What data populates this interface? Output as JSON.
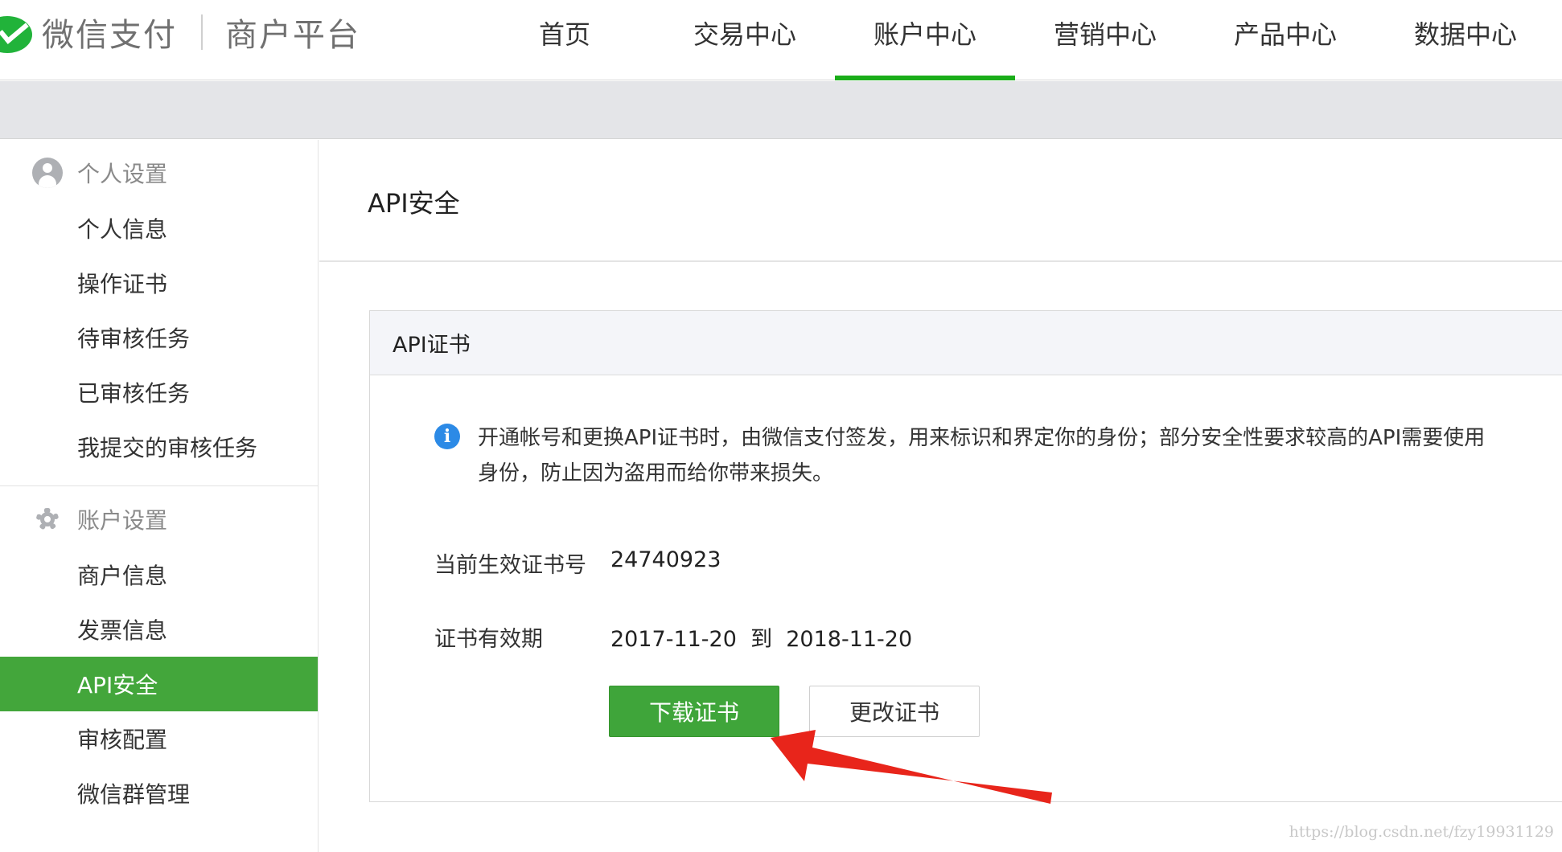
{
  "header": {
    "brand": "微信支付",
    "brand_sub": "商户平台",
    "nav": [
      "首页",
      "交易中心",
      "账户中心",
      "营销中心",
      "产品中心",
      "数据中心"
    ],
    "active_nav": "账户中心"
  },
  "sidebar": {
    "groups": [
      {
        "title": "个人设置",
        "icon": "person-icon",
        "items": [
          "个人信息",
          "操作证书",
          "待审核任务",
          "已审核任务",
          "我提交的审核任务"
        ]
      },
      {
        "title": "账户设置",
        "icon": "gear-icon",
        "items": [
          "商户信息",
          "发票信息",
          "API安全",
          "审核配置",
          "微信群管理"
        ]
      }
    ],
    "active_item": "API安全"
  },
  "main": {
    "page_title": "API安全",
    "card": {
      "title": "API证书",
      "notice_line1": "开通帐号和更换API证书时，由微信支付签发，用来标识和界定你的身份；部分安全性要求较高的API需要使用",
      "notice_line2": "身份，防止因为盗用而给你带来损失。",
      "cert_no_label": "当前生效证书号",
      "cert_no_value": "24740923",
      "validity_label": "证书有效期",
      "validity_value": "2017-11-20  到  2018-11-20",
      "download_button": "下载证书",
      "change_button": "更改证书"
    }
  },
  "watermark": "https://blog.csdn.net/fzy19931129",
  "colors": {
    "accent_green": "#1aad19",
    "active_sidebar": "#43a63b",
    "info_blue": "#2c8ae6",
    "annotation_red": "#e8251b"
  }
}
